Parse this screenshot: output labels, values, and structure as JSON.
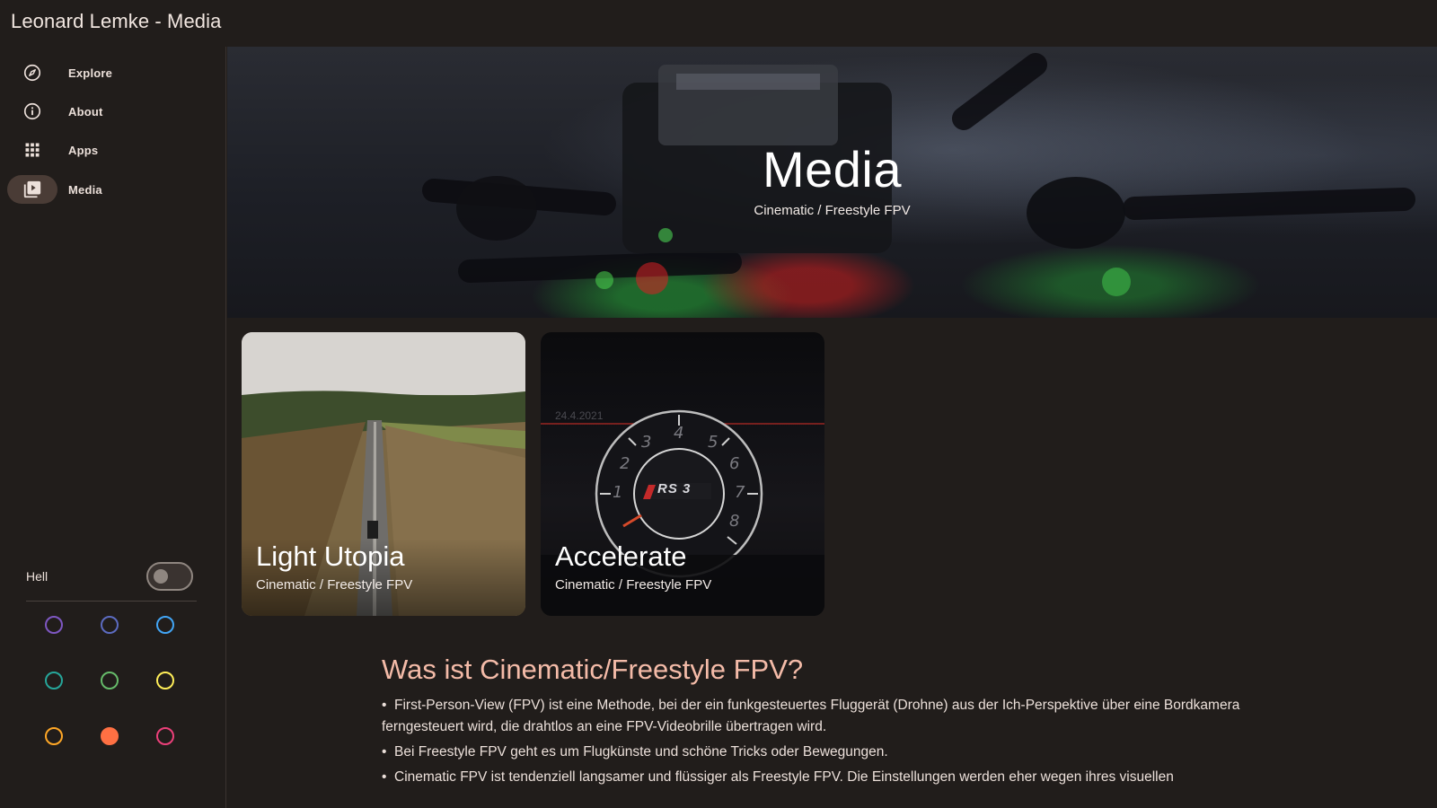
{
  "app": {
    "title": "Leonard Lemke - Media"
  },
  "sidebar": {
    "items": [
      {
        "label": "Explore",
        "icon": "compass-icon",
        "active": false
      },
      {
        "label": "About",
        "icon": "info-icon",
        "active": false
      },
      {
        "label": "Apps",
        "icon": "apps-grid-icon",
        "active": false
      },
      {
        "label": "Media",
        "icon": "video-library-icon",
        "active": true
      }
    ],
    "theme_toggle": {
      "label": "Hell",
      "checked": false
    },
    "color_swatches": [
      {
        "color": "#7e57c2",
        "selected": false
      },
      {
        "color": "#5c6bc0",
        "selected": false
      },
      {
        "color": "#42a5f5",
        "selected": false
      },
      {
        "color": "#26a69a",
        "selected": false
      },
      {
        "color": "#66bb6a",
        "selected": false
      },
      {
        "color": "#ffee58",
        "selected": false
      },
      {
        "color": "#ffa726",
        "selected": false
      },
      {
        "color": "#ff7043",
        "selected": true
      },
      {
        "color": "#ec407a",
        "selected": false
      }
    ]
  },
  "hero": {
    "title": "Media",
    "subtitle": "Cinematic / Freestyle FPV"
  },
  "cards": [
    {
      "title": "Light Utopia",
      "subtitle": "Cinematic / Freestyle FPV"
    },
    {
      "title": "Accelerate",
      "subtitle": "Cinematic / Freestyle FPV",
      "overlay_date": "24.4.2021",
      "badge": "RS 3"
    }
  ],
  "article": {
    "heading": "Was ist Cinematic/Freestyle FPV?",
    "bullets": [
      "First-Person-View (FPV) ist eine Methode, bei der ein funkgesteuertes Fluggerät (Drohne) aus der Ich-Perspektive über eine Bordkamera ferngesteuert wird, die drahtlos an eine FPV-Videobrille übertragen wird.",
      "Bei Freestyle FPV geht es um Flugkünste und schöne Tricks oder Bewegungen.",
      "Cinematic FPV ist tendenziell langsamer und flüssiger als Freestyle FPV. Die Einstellungen werden eher wegen ihres visuellen"
    ]
  },
  "colors": {
    "background": "#211d1b",
    "accent": "#f4bba8",
    "active_nav": "#4a3c36"
  }
}
